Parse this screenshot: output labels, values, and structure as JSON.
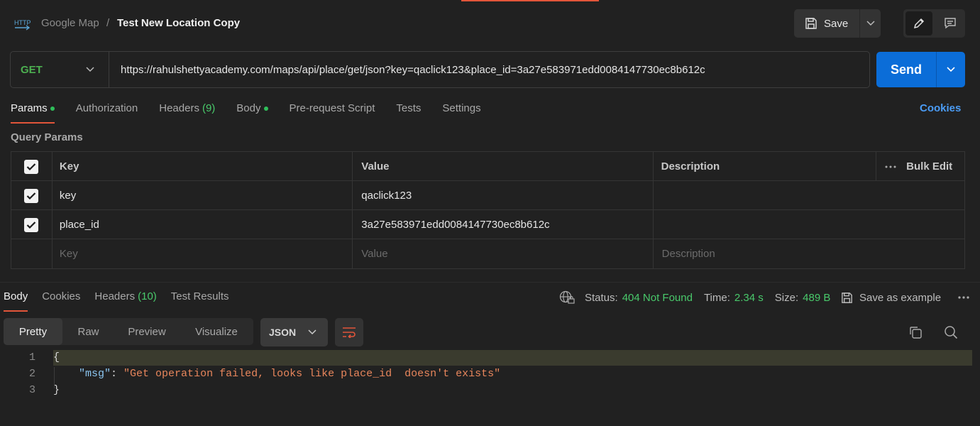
{
  "header": {
    "breadcrumb_parent": "Google Map",
    "breadcrumb_sep": "/",
    "request_name": "Test New Location Copy",
    "save_label": "Save"
  },
  "request": {
    "method": "GET",
    "url": "https://rahulshettyacademy.com/maps/api/place/get/json?key=qaclick123&place_id=3a27e583971edd0084147730ec8b612c",
    "send_label": "Send"
  },
  "request_tabs": {
    "params": "Params",
    "authorization": "Authorization",
    "headers": "Headers",
    "headers_count": "(9)",
    "body": "Body",
    "pre_request": "Pre-request Script",
    "tests": "Tests",
    "settings": "Settings",
    "cookies": "Cookies"
  },
  "query_params": {
    "title": "Query Params",
    "columns": {
      "key": "Key",
      "value": "Value",
      "description": "Description",
      "bulk_edit": "Bulk Edit"
    },
    "rows": [
      {
        "key": "key",
        "value": "qaclick123",
        "description": ""
      },
      {
        "key": "place_id",
        "value": "3a27e583971edd0084147730ec8b612c",
        "description": ""
      }
    ],
    "placeholders": {
      "key": "Key",
      "value": "Value",
      "description": "Description"
    }
  },
  "response_tabs": {
    "body": "Body",
    "cookies": "Cookies",
    "headers": "Headers",
    "headers_count": "(10)",
    "test_results": "Test Results"
  },
  "response_meta": {
    "status_label": "Status:",
    "status_value": "404 Not Found",
    "time_label": "Time:",
    "time_value": "2.34 s",
    "size_label": "Size:",
    "size_value": "489 B",
    "save_example": "Save as example"
  },
  "view_tabs": [
    "Pretty",
    "Raw",
    "Preview",
    "Visualize"
  ],
  "format": "JSON",
  "code": {
    "line_numbers": [
      "1",
      "2",
      "3"
    ],
    "open_brace": "{",
    "key": "\"msg\"",
    "colon": ": ",
    "value": "\"Get operation failed, looks like place_id  doesn't exists\"",
    "close_brace": "}"
  },
  "colors": {
    "accent": "#e2553a",
    "send": "#0b6dd8",
    "method_get": "#4caf50",
    "status_ok_text": "#49c96b",
    "link": "#4b9cf5"
  }
}
